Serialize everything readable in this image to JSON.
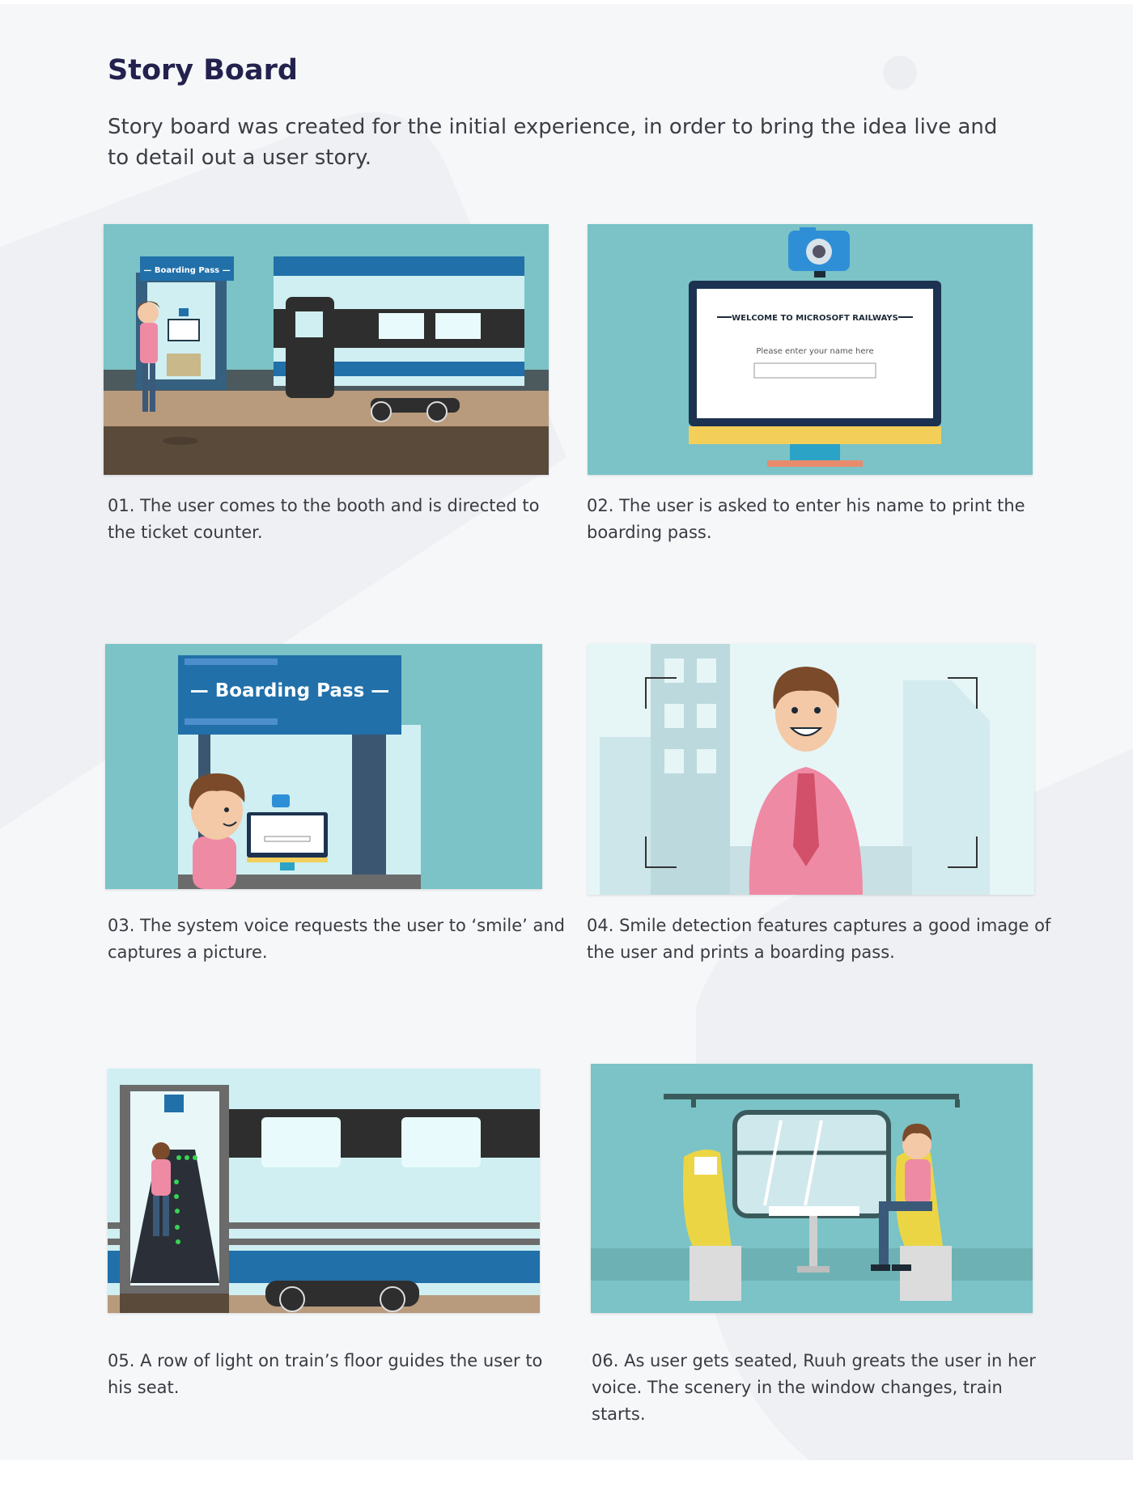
{
  "header": {
    "title": "Story Board",
    "intro": "Story board was created for the initial experience, in order to bring the idea live and to detail out a user story."
  },
  "panels": [
    {
      "caption": "01. The user comes to the booth and is directed to the ticket counter.",
      "booth_sign": "— Boarding Pass —"
    },
    {
      "caption": "02. The user is asked to enter his name to print the boarding pass.",
      "screen_heading": "WELCOME TO MICROSOFT RAILWAYS",
      "screen_placeholder": "Please enter your name here"
    },
    {
      "caption": "03. The system voice requests the user to ‘smile’ and captures a picture.",
      "booth_sign": "— Boarding Pass —"
    },
    {
      "caption": "04. Smile detection features captures a good image of the user and prints a boarding pass."
    },
    {
      "caption": "05. A row of light on train’s floor guides the user to his seat."
    },
    {
      "caption": "06. As user gets seated, Ruuh greats the user in her voice. The scenery in the window changes, train starts."
    }
  ],
  "colors": {
    "teal_background": "#7bc3c6",
    "title": "#23214d",
    "body_text": "#3a3a42",
    "train_blue": "#2170a9",
    "shirt_pink": "#ef8aa4",
    "seat_yellow": "#ecd545"
  }
}
